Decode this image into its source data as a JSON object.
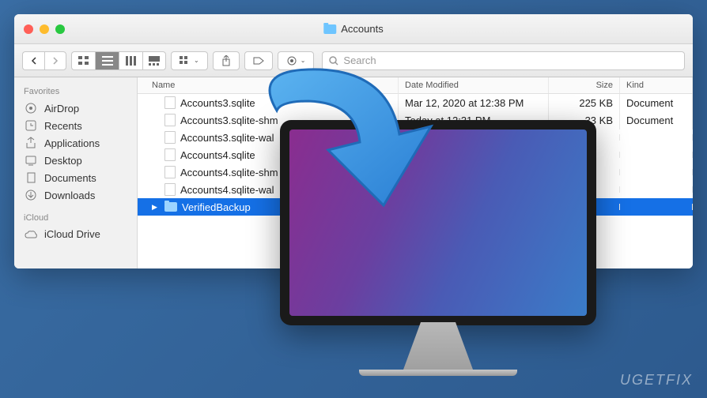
{
  "window": {
    "title": "Accounts"
  },
  "toolbar": {
    "search_placeholder": "Search"
  },
  "sidebar": {
    "sections": [
      {
        "label": "Favorites",
        "items": [
          {
            "icon": "airdrop",
            "label": "AirDrop"
          },
          {
            "icon": "recents",
            "label": "Recents"
          },
          {
            "icon": "apps",
            "label": "Applications"
          },
          {
            "icon": "desktop",
            "label": "Desktop"
          },
          {
            "icon": "documents",
            "label": "Documents"
          },
          {
            "icon": "downloads",
            "label": "Downloads"
          }
        ]
      },
      {
        "label": "iCloud",
        "items": [
          {
            "icon": "icloud",
            "label": "iCloud Drive"
          }
        ]
      }
    ]
  },
  "columns": {
    "name": "Name",
    "date": "Date Modified",
    "size": "Size",
    "kind": "Kind"
  },
  "files": [
    {
      "name": "Accounts3.sqlite",
      "date": "Mar 12, 2020 at 12:38 PM",
      "size": "225 KB",
      "kind": "Document",
      "type": "file"
    },
    {
      "name": "Accounts3.sqlite-shm",
      "date": "Today at 12:31 PM",
      "size": "33 KB",
      "kind": "Document",
      "type": "file"
    },
    {
      "name": "Accounts3.sqlite-wal",
      "date": "",
      "size": "",
      "kind": "",
      "type": "file"
    },
    {
      "name": "Accounts4.sqlite",
      "date": "",
      "size": "",
      "kind": "",
      "type": "file"
    },
    {
      "name": "Accounts4.sqlite-shm",
      "date": "",
      "size": "",
      "kind": "",
      "type": "file"
    },
    {
      "name": "Accounts4.sqlite-wal",
      "date": "",
      "size": "",
      "kind": "",
      "type": "file"
    },
    {
      "name": "VerifiedBackup",
      "date": "",
      "size": "",
      "kind": "",
      "type": "folder",
      "selected": true
    }
  ],
  "watermark": "UGETFIX"
}
